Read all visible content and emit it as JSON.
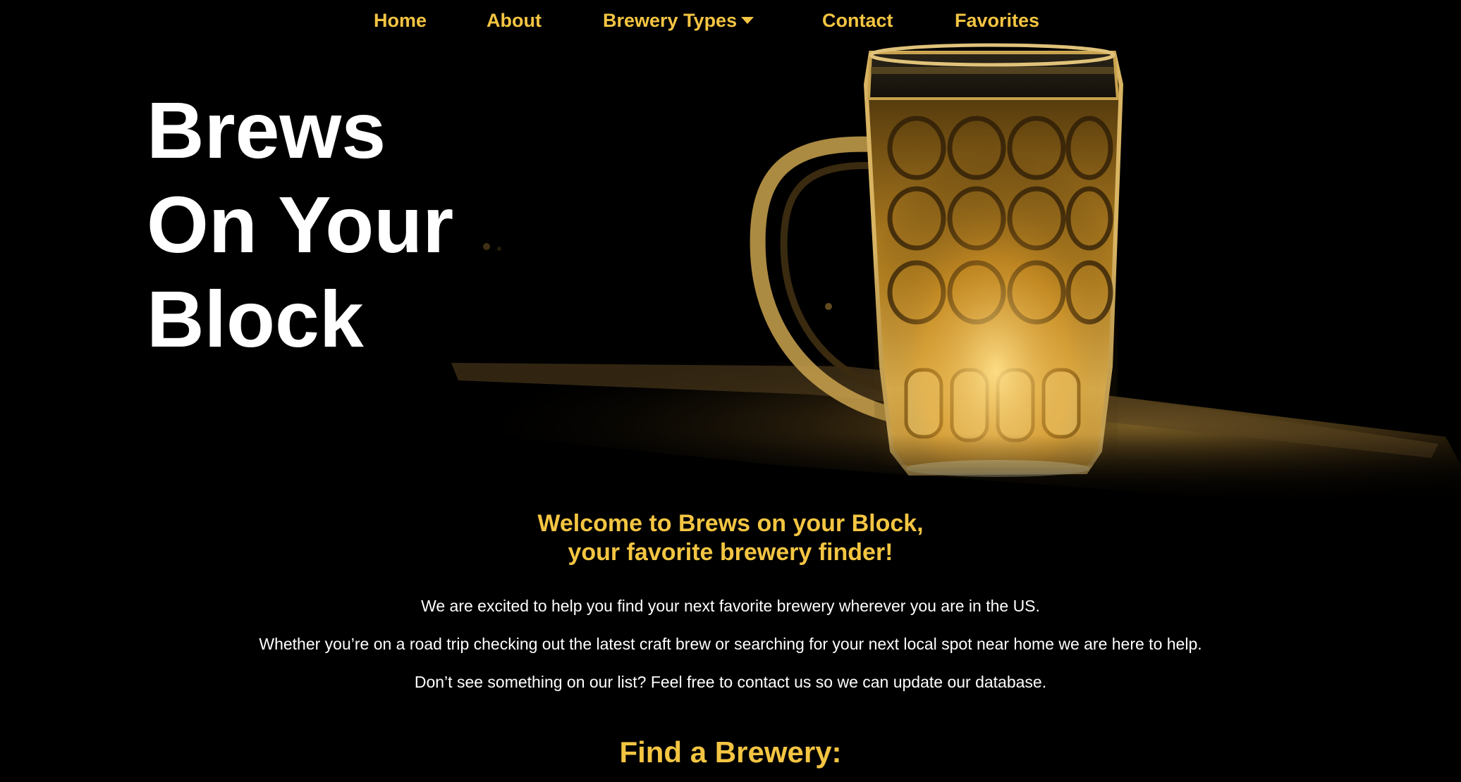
{
  "nav": {
    "home": "Home",
    "about": "About",
    "brewery_types": "Brewery Types",
    "contact": "Contact",
    "favorites": "Favorites",
    "dropdown_icon": "caret-down-icon"
  },
  "hero": {
    "title_line1": "Brews",
    "title_line2": "On Your",
    "title_line3": "Block",
    "image": "beer-mug-on-ledge"
  },
  "welcome": {
    "heading_line1": "Welcome to Brews on your Block,",
    "heading_line2": "your favorite brewery finder!",
    "paragraphs": [
      "We are excited to help you find your next favorite brewery wherever you are in the US.",
      "Whether you’re on a road trip checking out the latest craft brew or searching for your next local spot near home we are here to help.",
      "Don’t see something on our list? Feel free to contact us so we can update our database."
    ]
  },
  "find": {
    "heading": "Find a Brewery:"
  },
  "colors": {
    "accent": "#f4c542",
    "background": "#000000",
    "text": "#ffffff"
  }
}
